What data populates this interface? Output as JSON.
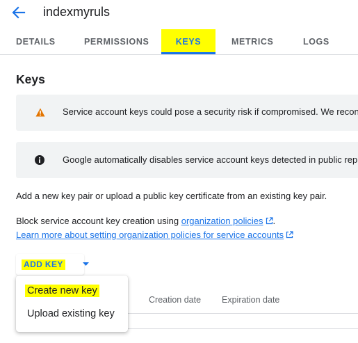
{
  "header": {
    "title": "indexmyruls",
    "back_icon": "arrow-back-icon"
  },
  "tabs": [
    {
      "label": "DETAILS"
    },
    {
      "label": "PERMISSIONS"
    },
    {
      "label": "KEYS"
    },
    {
      "label": "METRICS"
    },
    {
      "label": "LOGS"
    }
  ],
  "colors": {
    "accent": "#1a73e8",
    "highlight": "#ffff00",
    "warning": "#e37400",
    "banner_bg": "#f1f3f4"
  },
  "keys": {
    "title": "Keys",
    "warning_banner": {
      "icon": "warning-icon",
      "text": "Service account keys could pose a security risk if compromised. We recon"
    },
    "info_banner": {
      "icon": "info-icon",
      "text": "Google automatically disables service account keys detected in public rep"
    },
    "intro": "Add a new key pair or upload a public key certificate from an existing key pair.",
    "block_prefix": "Block service account key creation using ",
    "block_link": "organization policies",
    "block_suffix": ".",
    "learn_more_link": "Learn more about setting organization policies for service accounts",
    "add_key_button": "ADD KEY",
    "table_headers": {
      "creation_date": "Creation date",
      "expiration_date": "Expiration date"
    },
    "menu": [
      {
        "label": "Create new key"
      },
      {
        "label": "Upload existing key"
      }
    ]
  }
}
